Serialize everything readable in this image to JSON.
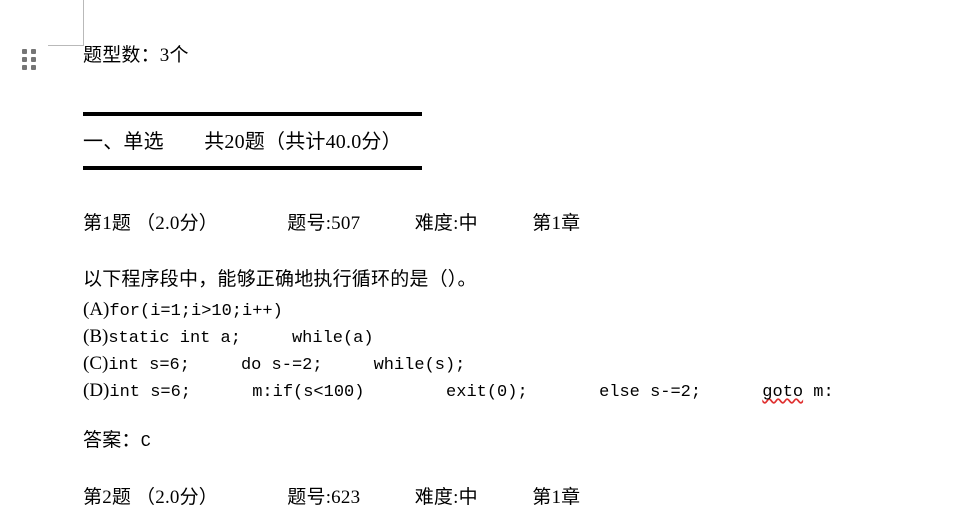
{
  "document": {
    "meta_line": "题型数：3个",
    "section": {
      "title": "一、单选　　共20题（共计40.0分）",
      "index_label": "一、",
      "name": "单选",
      "question_count": 20,
      "total_points": "40.0",
      "rule_color": "#000000"
    },
    "questions": [
      {
        "meta": "第1题 （2.0分）              题号:507           难度:中           第1章",
        "number_label": "第1题",
        "points_label": "（2.0分）",
        "id_label": "题号:507",
        "difficulty_label": "难度:中",
        "chapter_label": "第1章",
        "stem": "以下程序段中，能够正确地执行循环的是（）。",
        "options": [
          {
            "tag": "(A)",
            "code": "for(i=1;i>10;i++)",
            "code_tail": "",
            "spell_error": ""
          },
          {
            "tag": "(B)",
            "code": "static int a;     while(a)",
            "code_tail": "",
            "spell_error": ""
          },
          {
            "tag": "(C)",
            "code": "int s=6;     do s-=2;     while(s);",
            "code_tail": "",
            "spell_error": ""
          },
          {
            "tag": "(D)",
            "code": "int s=6;      m:if(s<100)        exit(0);       else s-=2;      ",
            "code_tail": " m:",
            "spell_error": "goto"
          }
        ],
        "answer_label": "答案：",
        "answer_value": "C"
      },
      {
        "meta": "第2题 （2.0分）              题号:623           难度:中           第1章",
        "number_label": "第2题",
        "points_label": "（2.0分）",
        "id_label": "题号:623",
        "difficulty_label": "难度:中",
        "chapter_label": "第1章"
      }
    ]
  },
  "gutter": {
    "drag_handle_icon": "drag-dots-icon",
    "margin_guide_color": "#b9b9b9"
  }
}
